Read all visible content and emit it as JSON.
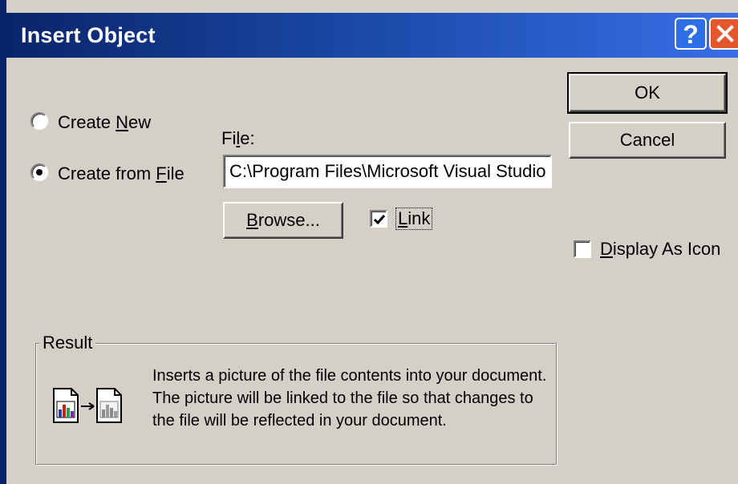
{
  "dialog": {
    "title": "Insert Object",
    "help_glyph": "?",
    "icons": {
      "help": "help-icon",
      "close": "close-icon"
    }
  },
  "options": {
    "create_new": {
      "pre": "Create ",
      "accel": "N",
      "post": "ew",
      "selected": false
    },
    "create_from_file": {
      "pre": "Create from ",
      "accel": "F",
      "post": "ile",
      "selected": true
    }
  },
  "file": {
    "label_pre": "Fi",
    "label_accel": "l",
    "label_post": "e:",
    "value": "C:\\Program Files\\Microsoft Visual Studio"
  },
  "browse": {
    "accel": "B",
    "rest": "rowse..."
  },
  "link": {
    "accel": "L",
    "rest": "ink",
    "checked": true
  },
  "buttons": {
    "ok": "OK",
    "cancel": "Cancel"
  },
  "display_as_icon": {
    "accel": "D",
    "rest": "isplay As Icon",
    "checked": false
  },
  "result": {
    "label": "Result",
    "text": "Inserts a picture of the file contents into your document.  The picture will be linked to the file so that changes to the file will be reflected in your document.",
    "icon": "linked-picture-icon"
  }
}
